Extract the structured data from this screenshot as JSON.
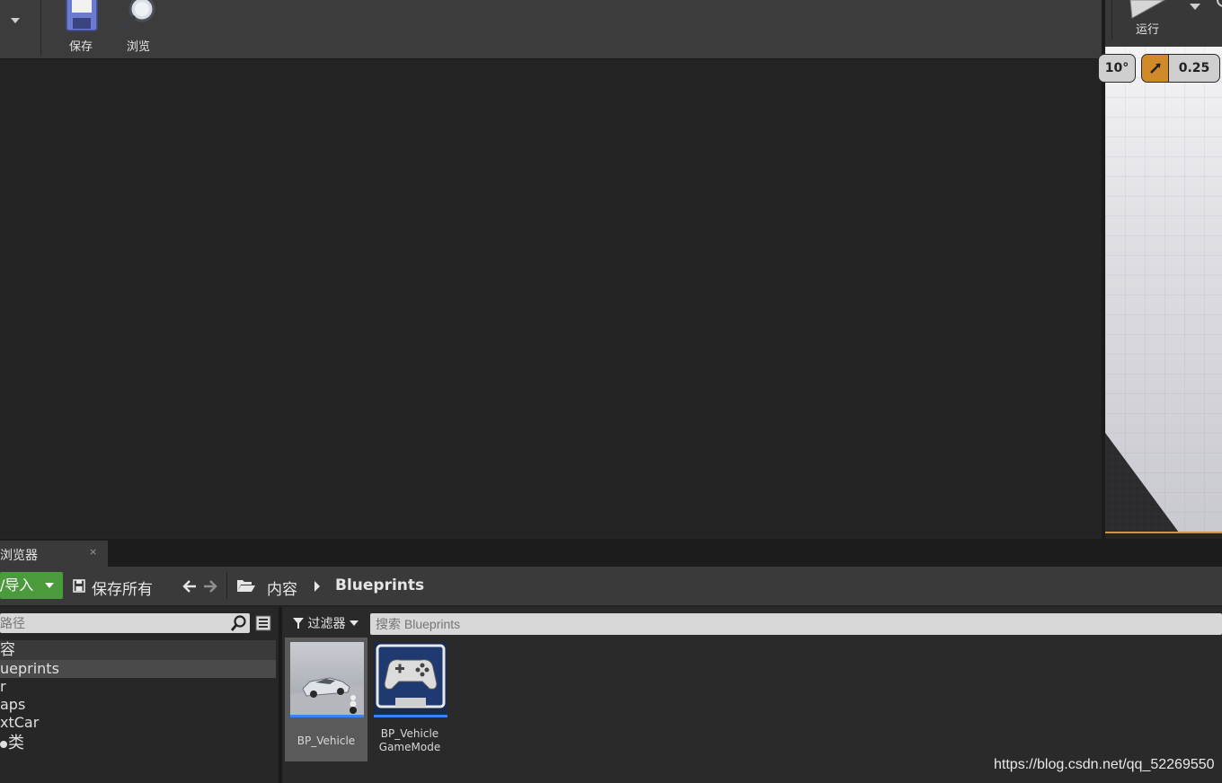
{
  "toolbar": {
    "save_label": "保存",
    "browse_label": "浏览",
    "run_label": "运行"
  },
  "viewport": {
    "angle_snap": "10°",
    "scale_snap": "0.25"
  },
  "content_browser": {
    "tab_title": "浏览器",
    "tab_close": "×",
    "import_label": "/导入",
    "save_all_label": "保存所有",
    "breadcrumb": [
      "内容",
      "Blueprints"
    ],
    "path_search_placeholder": "路径",
    "tree": [
      "容",
      "ueprints",
      "r",
      "aps",
      "xtCar",
      "类"
    ],
    "selected_tree_index": 1,
    "filter_label": "过滤器",
    "asset_search_placeholder": "搜索 Blueprints",
    "assets": [
      {
        "name": "BP_Vehicle"
      },
      {
        "name_line1": "BP_Vehicle",
        "name_line2": "GameMode"
      }
    ]
  },
  "watermark": "https://blog.csdn.net/qq_52269550",
  "colors": {
    "import_green": "#4b9b3c",
    "snap_orange": "#d08a2a",
    "asset_underline": "#3b82f6"
  }
}
